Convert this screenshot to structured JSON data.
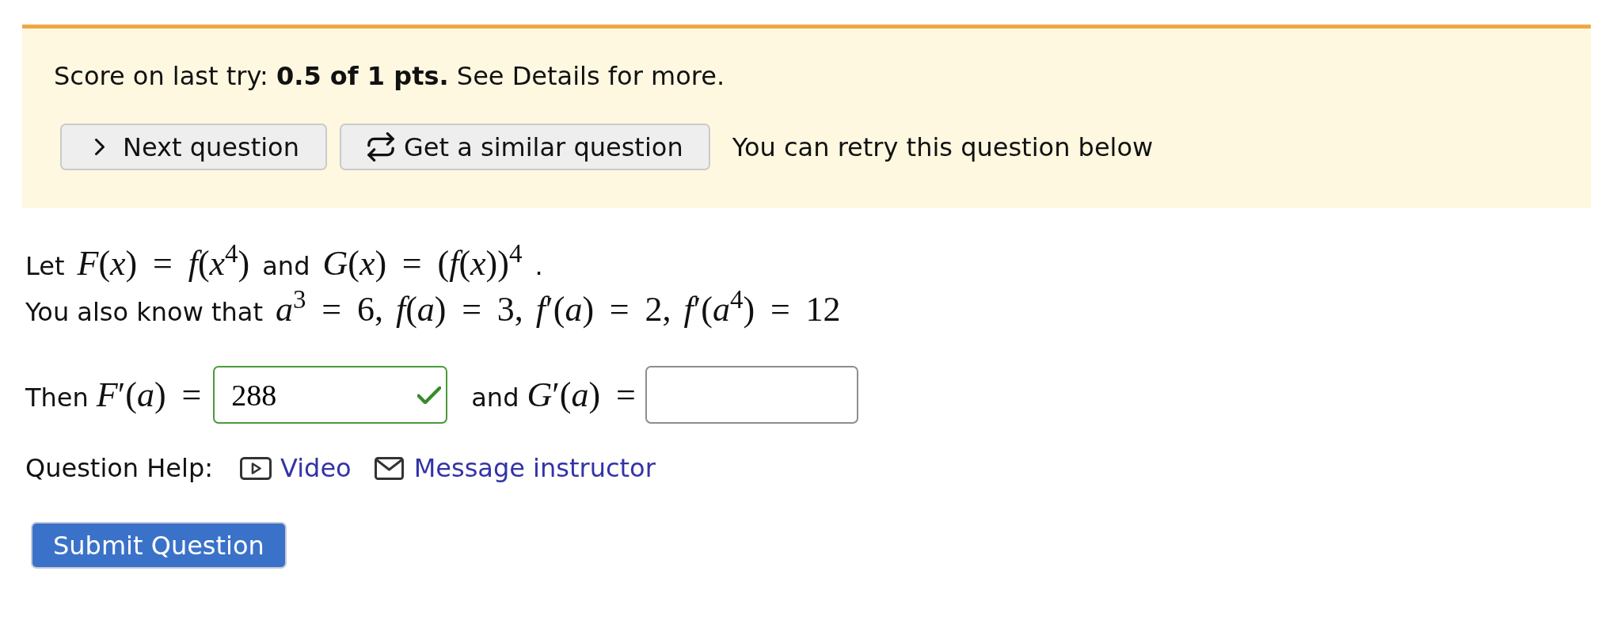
{
  "feedback": {
    "score": "Score on last try: **0.5 of 1 pts.** See Details for more.",
    "buttons": [
      {
        "kind": "next",
        "label": "Next question"
      },
      {
        "kind": "similar",
        "label": "Get a similar question"
      }
    ],
    "note": "You can retry this question below"
  },
  "question": {
    "lines": [
      [
        {
          "kind": "text",
          "text": "Let"
        },
        {
          "kind": "math",
          "text": "*F*(*x*) = *f*(*x*$^{4}$)"
        },
        {
          "kind": "text",
          "text": "and"
        },
        {
          "kind": "math",
          "text": "*G*(*x*) = (*f*(*x*))$^{4}$"
        },
        {
          "kind": "text",
          "text": "."
        }
      ],
      [
        {
          "kind": "text",
          "text": "You also know that"
        },
        {
          "kind": "math",
          "text": "*a*$^{3}$ = 6,"
        },
        {
          "kind": "math",
          "text": "*f*(*a*) = 3,"
        },
        {
          "kind": "math",
          "text": "*f*′(*a*) = 2,"
        },
        {
          "kind": "math",
          "text": "*f*′(*a*$^{4}$) = 12"
        }
      ]
    ]
  },
  "answers": [
    {
      "kind": "prompt",
      "parts": [
        {
          "kind": "text",
          "text": "Then"
        },
        {
          "kind": "math",
          "text": "*F*′(*a*) ="
        }
      ]
    },
    {
      "kind": "field",
      "value": "288",
      "correct": true
    },
    {
      "kind": "prompt",
      "parts": [
        {
          "kind": "text",
          "text": "and"
        },
        {
          "kind": "math",
          "text": "*G*′(*a*) ="
        }
      ]
    },
    {
      "kind": "field",
      "correct": false
    }
  ],
  "help": {
    "label": "Question Help:",
    "links": [
      {
        "kind": "video",
        "label": "Video"
      },
      {
        "kind": "message",
        "label": "Message instructor"
      }
    ]
  },
  "submit": {
    "label": "Submit Question"
  }
}
